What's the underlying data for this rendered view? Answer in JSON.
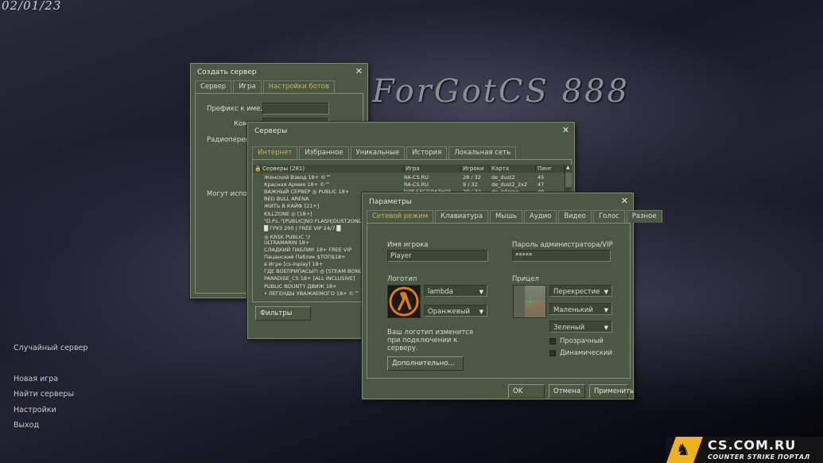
{
  "date_stamp": "02/01/23",
  "game_logo_text": "ForGotCS 888",
  "main_menu": [
    {
      "label": "Случайный сервер"
    },
    {
      "label": "Новая игра"
    },
    {
      "label": "Найти серверы"
    },
    {
      "label": "Настройки"
    },
    {
      "label": "Выход"
    }
  ],
  "create_server": {
    "title": "Создать сервер",
    "tabs": [
      "Сервер",
      "Игра",
      "Настройки ботов"
    ],
    "fields": {
      "prefix_label": "Префикс к име...",
      "team_label": "Кома",
      "radio_label": "Радиопереговор",
      "can_use_label": "Могут исполь"
    }
  },
  "servers": {
    "title": "Серверы",
    "tabs": [
      "Интернет",
      "Избранное",
      "Уникальные",
      "История",
      "Локальная сеть"
    ],
    "columns": {
      "name": "Серверы (281)",
      "game": "Игра",
      "players": "Игроки",
      "map": "Карта",
      "ping": "Пинг"
    },
    "rows": [
      {
        "name": "Женский Взвод 18+ ©™",
        "game": "RA-CS.RU",
        "players": "28 / 32",
        "map": "de_dust2",
        "ping": "45"
      },
      {
        "name": "Красная Армия 18+ ©™",
        "game": "RA-CS.RU",
        "players": "9 / 32",
        "map": "de_dust2_2x2",
        "ping": "47"
      },
      {
        "name": "ВАЖНЫЙ СЕРВЕР ◎ PUBLIC 18+",
        "game": "[VIP БЕСПЛАТНО]",
        "players": "20 / 32",
        "map": "de_inferno",
        "ping": "49"
      },
      {
        "name": "RED BULL ARENA",
        "game": "",
        "players": "",
        "map": "",
        "ping": ""
      },
      {
        "name": "ЖИТЬ В КАЙФ [21+]",
        "game": "",
        "players": "",
        "map": "",
        "ping": ""
      },
      {
        "name": "KILLZONE ◎ [18+]",
        "game": "",
        "players": "",
        "map": "",
        "ping": ""
      },
      {
        "name": "\"D.P.L.\"[PUBLIC|NO FLASH|DUST2ONLY]",
        "game": "",
        "players": "",
        "map": "",
        "ping": ""
      },
      {
        "name": "█ ГРУЗ 200 | FREE VIP 24/7 █",
        "game": "",
        "players": "",
        "map": "",
        "ping": ""
      },
      {
        "name": "◎ KRSK PUBLIC ツ",
        "game": "",
        "players": "",
        "map": "",
        "ping": ""
      },
      {
        "name": "ULTRAMARIN 18+",
        "game": "",
        "players": "",
        "map": "",
        "ping": ""
      },
      {
        "name": "СЛАДКИЙ ПАБЛИК 18+ FREE VIP",
        "game": "",
        "players": "",
        "map": "",
        "ping": ""
      },
      {
        "name": "Пацанский Паблик $TOП$18+",
        "game": "",
        "players": "",
        "map": "",
        "ping": ""
      },
      {
        "name": "в Игре [cs-inplay] 18+",
        "game": "",
        "players": "",
        "map": "",
        "ping": ""
      },
      {
        "name": "ГДЕ ВОЕПРИПАСЫ?! ◎ [STEAM BONUS]",
        "game": "",
        "players": "",
        "map": "",
        "ping": ""
      },
      {
        "name": "PARADISE_CS 18+ [ALL INCLUSIVE]",
        "game": "",
        "players": "",
        "map": "",
        "ping": ""
      },
      {
        "name": "PUBLIC BOUNTY ДВИЖ 18+",
        "game": "",
        "players": "",
        "map": "",
        "ping": ""
      },
      {
        "name": "• ЛЕГЕНДЫ УВАЖАЕМОГО 18+ ©™",
        "game": "",
        "players": "",
        "map": "",
        "ping": ""
      }
    ],
    "filters_button": "Фильтры"
  },
  "options": {
    "title": "Параметры",
    "tabs": [
      "Сетевой режим",
      "Клавиатура",
      "Мышь",
      "Аудио",
      "Видео",
      "Голос",
      "Разное"
    ],
    "player_name_label": "Имя игрока",
    "player_name_value": "Player",
    "admin_password_label": "Пароль администратора/VIP",
    "admin_password_value": "*****",
    "logo_label": "Логотип",
    "logo_value": "lambda",
    "logo_color_value": "Оранжевый",
    "logo_note": "Ваш логотип изменится при подключении к серверу.",
    "advanced_button": "Дополнительно...",
    "crosshair_label": "Прицел",
    "crosshair_style": "Перекрестие",
    "crosshair_size": "Маленький",
    "crosshair_color": "Зеленый",
    "transparent_label": "Прозрачный",
    "dynamic_label": "Динамический",
    "ok_button": "OK",
    "cancel_button": "Отмена",
    "apply_button": "Применить"
  },
  "watermark": {
    "site": "CS.COM.RU",
    "tagline": "COUNTER STRIKE ПОРТАЛ"
  }
}
